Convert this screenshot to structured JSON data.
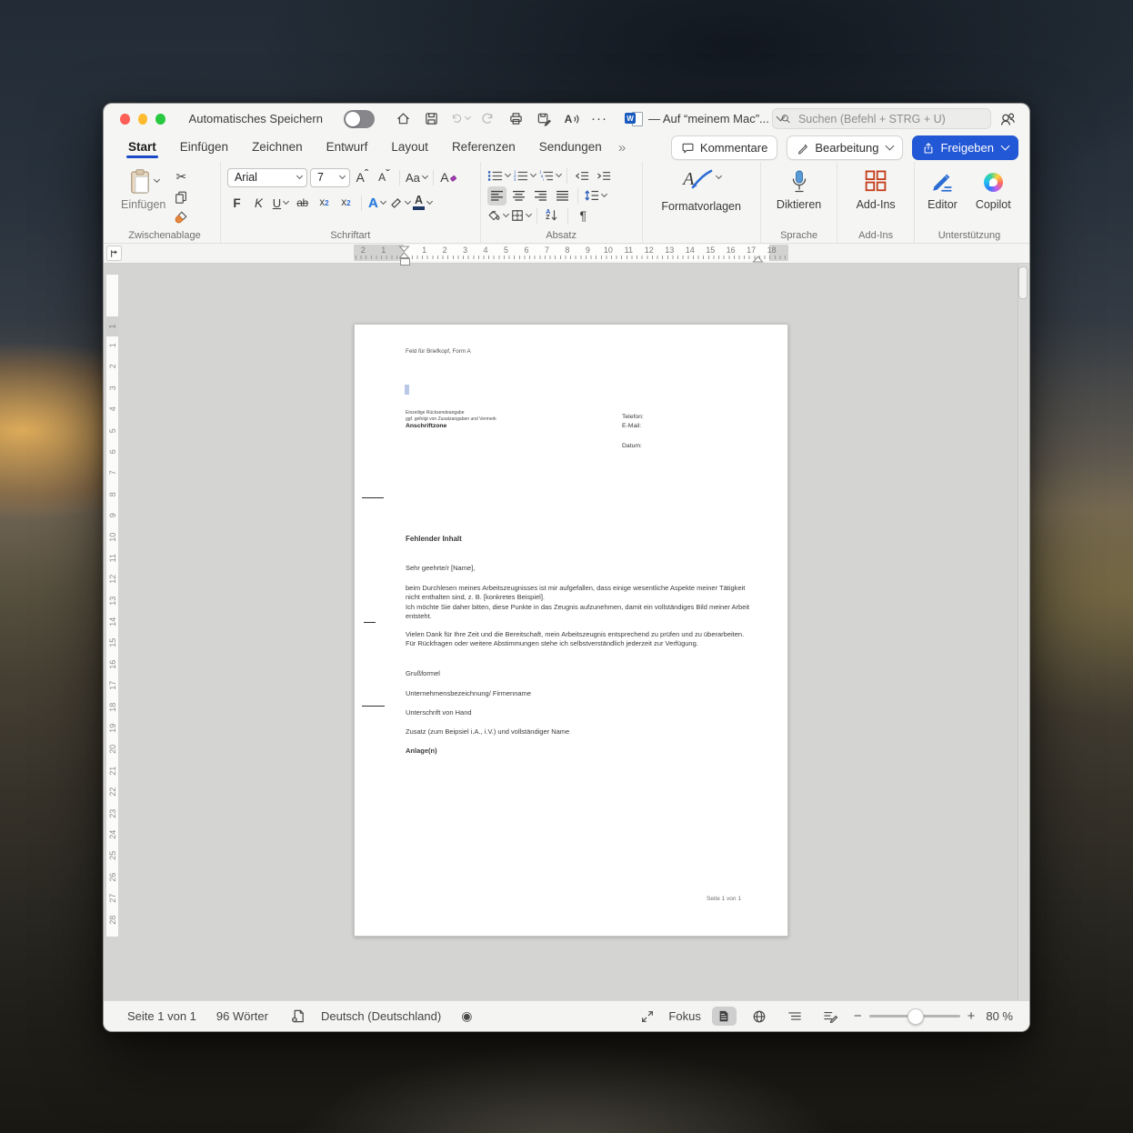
{
  "window": {
    "autosave_label": "Automatisches Speichern",
    "doc_title": "— Auf “meinem Mac”...",
    "search_placeholder": "Suchen (Befehl + STRG + U)"
  },
  "tabs": {
    "start": "Start",
    "einfuegen": "Einfügen",
    "zeichnen": "Zeichnen",
    "entwurf": "Entwurf",
    "layout": "Layout",
    "referenzen": "Referenzen",
    "sendungen": "Sendungen",
    "overflow": "»"
  },
  "top_actions": {
    "kommentare": "Kommentare",
    "bearbeitung": "Bearbeitung",
    "freigeben": "Freigeben"
  },
  "ribbon": {
    "paste_label": "Einfügen",
    "font_name": "Arial",
    "font_size": "7",
    "grow_font": "A",
    "shrink_font": "A",
    "change_case": "Aa",
    "bold": "F",
    "italic": "K",
    "underline": "U",
    "strikethrough": "ab",
    "subscript_base": "x",
    "subscript_mark": "2",
    "superscript_base": "x",
    "superscript_mark": "2",
    "text_effects": "A",
    "font_color": "A",
    "sort_a": "A",
    "sort_z": "Z",
    "styles_letter": "A",
    "read_aloud_letter": "A",
    "styles_label": "Formatvorlagen",
    "dictate_label": "Diktieren",
    "addins_label": "Add-Ins",
    "editor_label": "Editor",
    "copilot_label": "Copilot",
    "group_labels": {
      "clipboard": "Zwischenablage",
      "font": "Schriftart",
      "paragraph": "Absatz",
      "language": "Sprache",
      "addins": "Add-Ins",
      "support": "Unterstützung"
    }
  },
  "icons": {
    "scissors": "✂",
    "record": "◉",
    "ellipsis": "···",
    "pilcrow": "¶",
    "caret_up": "ˆ",
    "caret_down": "ˇ"
  },
  "ruler": {
    "h_numbers": [
      "2",
      "1",
      "",
      "1",
      "2",
      "3",
      "4",
      "5",
      "6",
      "7",
      "8",
      "9",
      "10",
      "11",
      "12",
      "13",
      "14",
      "15",
      "16",
      "17",
      "18"
    ],
    "v_margin": "1",
    "v_numbers": [
      "1",
      "2",
      "3",
      "4",
      "5",
      "6",
      "7",
      "8",
      "9",
      "10",
      "11",
      "12",
      "13",
      "14",
      "15",
      "16",
      "17",
      "18",
      "19",
      "20",
      "21",
      "22",
      "23",
      "24",
      "25",
      "26",
      "27",
      "28"
    ]
  },
  "document": {
    "letterhead": "Feld für Briefkopf, Form A",
    "return_line1": "Einzeilige Rücksendeangabe",
    "return_line2": "ggf. gefolgt von Zusatzangaben und Vermerk",
    "return_line3": "Anschriftzone",
    "phone": "Telefon:",
    "email": "E-Mail:",
    "date": "Datum:",
    "heading": "Fehlender Inhalt",
    "salutation": "Sehr geehrte/r [Name],",
    "para1a": "beim Durchlesen meines Arbeitszeugnisses ist mir aufgefallen, dass einige wesentliche Aspekte meiner Tätigkeit nicht enthalten sind, z. B. [konkretes Beispiel].",
    "para1b": "Ich möchte Sie daher bitten, diese Punkte in das Zeugnis aufzunehmen, damit ein vollständiges Bild meiner Arbeit entsteht.",
    "para2": "Vielen Dank für Ihre Zeit und die Bereitschaft, mein Arbeitszeugnis entsprechend zu prüfen und zu überarbeiten. Für Rückfragen oder weitere Abstimmungen stehe ich selbstverständlich jederzeit zur Verfügung.",
    "closing": "Grußformel",
    "company": "Unternehmensbezeichnung/ Firmenname",
    "signature": "Unterschrift von Hand",
    "addition": "Zusatz (zum Beipsiel i.A., i.V.) und vollständiger Name",
    "attachments": "Anlage(n)",
    "page_number": "Seite 1 von 1"
  },
  "statusbar": {
    "page_count": "Seite 1 von 1",
    "word_count": "96 Wörter",
    "language": "Deutsch (Deutschland)",
    "focus_label": "Fokus",
    "zoom_minus": "−",
    "zoom_plus": "+",
    "zoom_level": "80 %"
  },
  "colors": {
    "accent_blue": "#1b49c8",
    "share_button_blue": "#2257d5",
    "word_logo_blue": "#185abd",
    "highlight_yellow": "#f5e400",
    "font_color_bar": "#1f3864",
    "addins_red": "#c43e1c",
    "traffic_red": "#ff5f57",
    "traffic_yellow": "#febb2e",
    "traffic_green": "#28c841"
  }
}
